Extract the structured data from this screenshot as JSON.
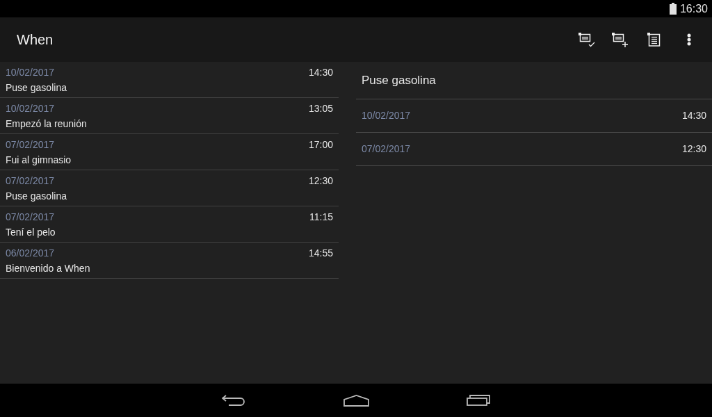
{
  "status_bar": {
    "time": "16:30"
  },
  "action_bar": {
    "title": "When"
  },
  "entries": [
    {
      "date": "10/02/2017",
      "time": "14:30",
      "title": "Puse gasolina"
    },
    {
      "date": "10/02/2017",
      "time": "13:05",
      "title": "Empezó la reunión"
    },
    {
      "date": "07/02/2017",
      "time": "17:00",
      "title": "Fui al gimnasio"
    },
    {
      "date": "07/02/2017",
      "time": "12:30",
      "title": "Puse gasolina"
    },
    {
      "date": "07/02/2017",
      "time": "11:15",
      "title": "Tení el pelo"
    },
    {
      "date": "06/02/2017",
      "time": "14:55",
      "title": "Bienvenido a When"
    }
  ],
  "detail": {
    "title": "Puse gasolina",
    "occurrences": [
      {
        "date": "10/02/2017",
        "time": "14:30"
      },
      {
        "date": "07/02/2017",
        "time": "12:30"
      }
    ]
  }
}
